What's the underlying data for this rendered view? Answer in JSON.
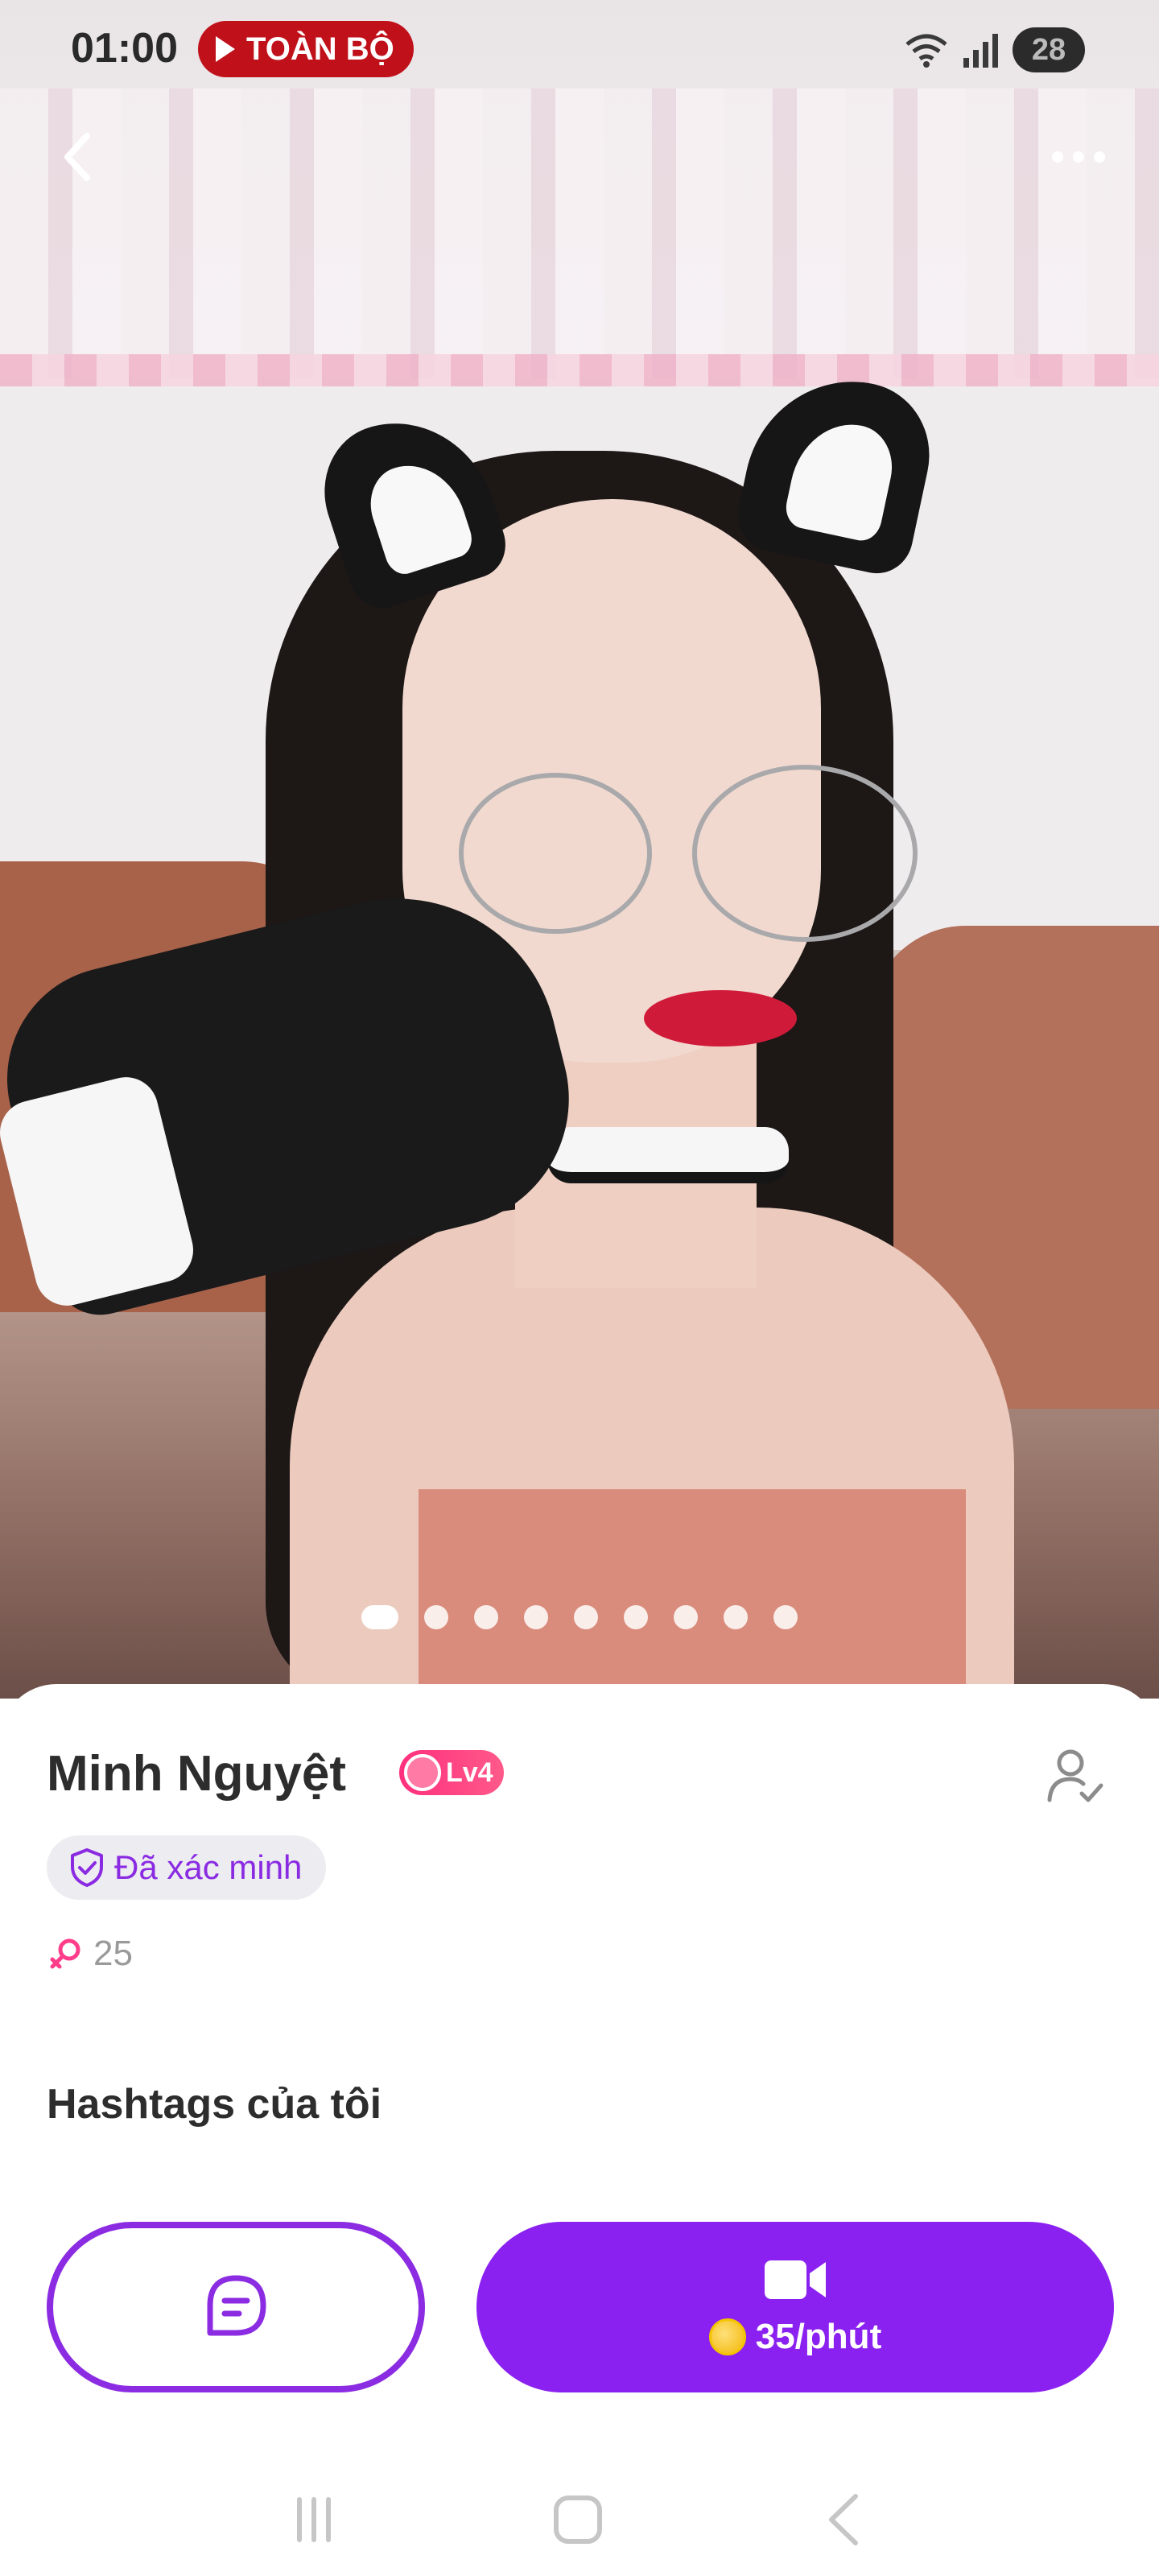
{
  "status_bar": {
    "time": "01:00",
    "recording_badge": "TOÀN BỘ",
    "battery": "28",
    "icons": [
      "wifi-icon",
      "signal-icon",
      "battery-icon"
    ]
  },
  "header": {
    "back_icon": "chevron-left-icon",
    "more_icon": "more-horizontal-icon"
  },
  "carousel": {
    "total_photos": 9,
    "active_index": 0
  },
  "profile": {
    "name": "Minh Nguyệt",
    "level": "Lv4",
    "verified_label": "Đã xác minh",
    "age": "25",
    "gender_icon": "female-icon",
    "follow_icon": "user-check-icon"
  },
  "hashtags": {
    "title": "Hashtags của tôi"
  },
  "actions": {
    "chat_icon": "message-icon",
    "call_icon": "video-camera-icon",
    "call_price": "35/phút",
    "coin_icon": "coin-icon"
  },
  "nav": {
    "icons": [
      "recents-icon",
      "home-icon",
      "back-icon"
    ]
  },
  "colors": {
    "accent": "#8b21f0",
    "level_badge": "#ff2f7d",
    "recording_badge": "#c0111b",
    "gender": "#ff3d8b"
  }
}
